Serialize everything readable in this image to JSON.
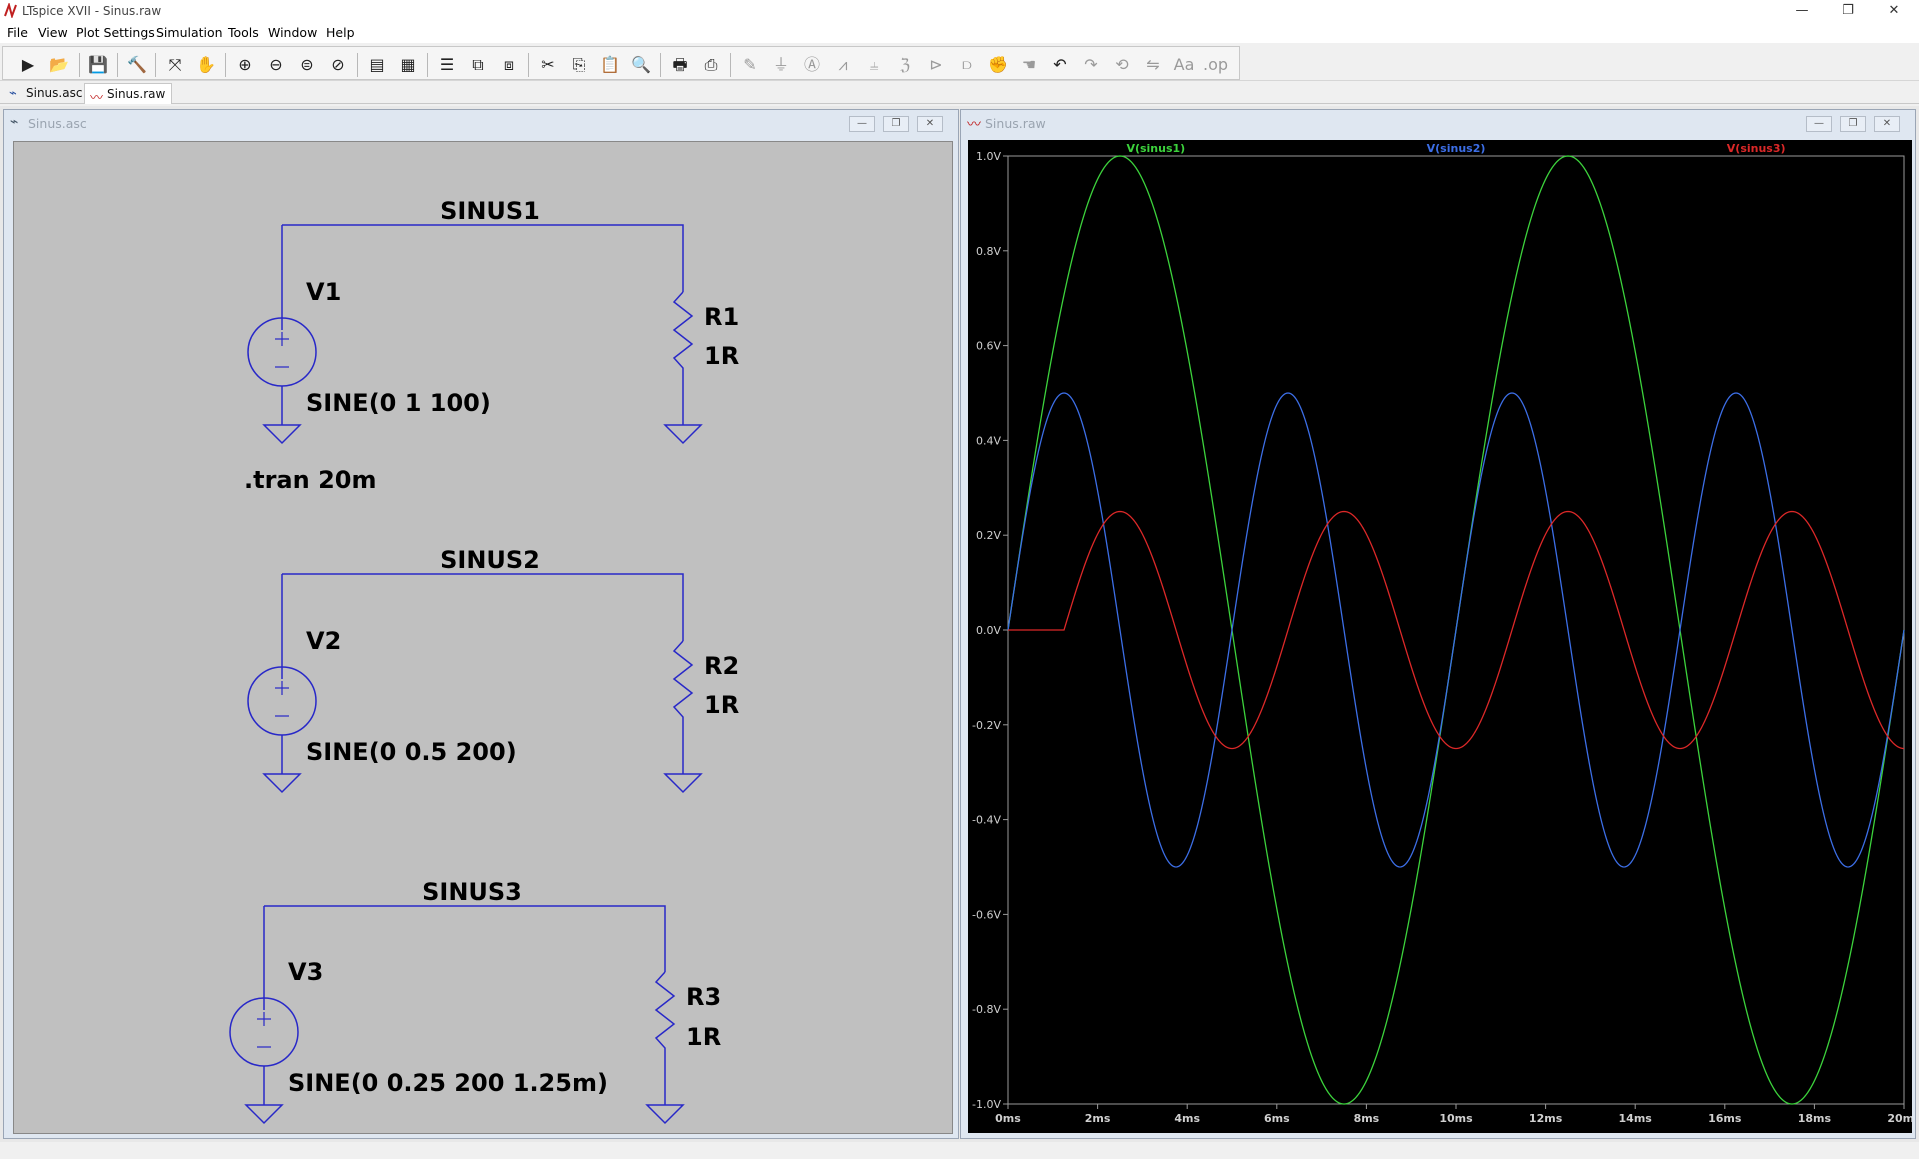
{
  "window": {
    "title": "LTspice XVII - Sinus.raw",
    "minimize": "—",
    "restore": "❐",
    "close": "✕"
  },
  "menu": [
    "File",
    "View",
    "Plot Settings",
    "Simulation",
    "Tools",
    "Window",
    "Help"
  ],
  "tabs": [
    {
      "label": "Sinus.asc"
    },
    {
      "label": "Sinus.raw"
    }
  ],
  "schematic_window": {
    "title": "Sinus.asc"
  },
  "plot_window": {
    "title": "Sinus.raw"
  },
  "schematic": {
    "directive": ".tran 20m",
    "circuits": [
      {
        "net": "SINUS1",
        "source": "V1",
        "value": "SINE(0 1 100)",
        "resistor": "R1",
        "rvalue": "1R"
      },
      {
        "net": "SINUS2",
        "source": "V2",
        "value": "SINE(0 0.5 200)",
        "resistor": "R2",
        "rvalue": "1R"
      },
      {
        "net": "SINUS3",
        "source": "V3",
        "value": "SINE(0 0.25 200 1.25m)",
        "resistor": "R3",
        "rvalue": "1R"
      }
    ],
    "colors": {
      "wire": "#2828c8",
      "background": "#c0c0c0",
      "text": "#000000"
    }
  },
  "chart_data": {
    "type": "line",
    "x_ticks": [
      "0ms",
      "2ms",
      "4ms",
      "6ms",
      "8ms",
      "10ms",
      "12ms",
      "14ms",
      "16ms",
      "18ms",
      "20ms"
    ],
    "y_ticks": [
      "1.0V",
      "0.8V",
      "0.6V",
      "0.4V",
      "0.2V",
      "0.0V",
      "-0.2V",
      "-0.4V",
      "-0.6V",
      "-0.8V",
      "-1.0V"
    ],
    "xlim_ms": [
      0,
      20
    ],
    "ylim": [
      -1.0,
      1.0
    ],
    "grid": false,
    "legend": "top",
    "series": [
      {
        "name": "V(sinus1)",
        "color": "#3cd23c",
        "amplitude": 1.0,
        "freq_hz": 100,
        "delay_ms": 0
      },
      {
        "name": "V(sinus2)",
        "color": "#3c6ee6",
        "amplitude": 0.5,
        "freq_hz": 200,
        "delay_ms": 0
      },
      {
        "name": "V(sinus3)",
        "color": "#dc2828",
        "amplitude": 0.25,
        "freq_hz": 200,
        "delay_ms": 1.25
      }
    ]
  }
}
